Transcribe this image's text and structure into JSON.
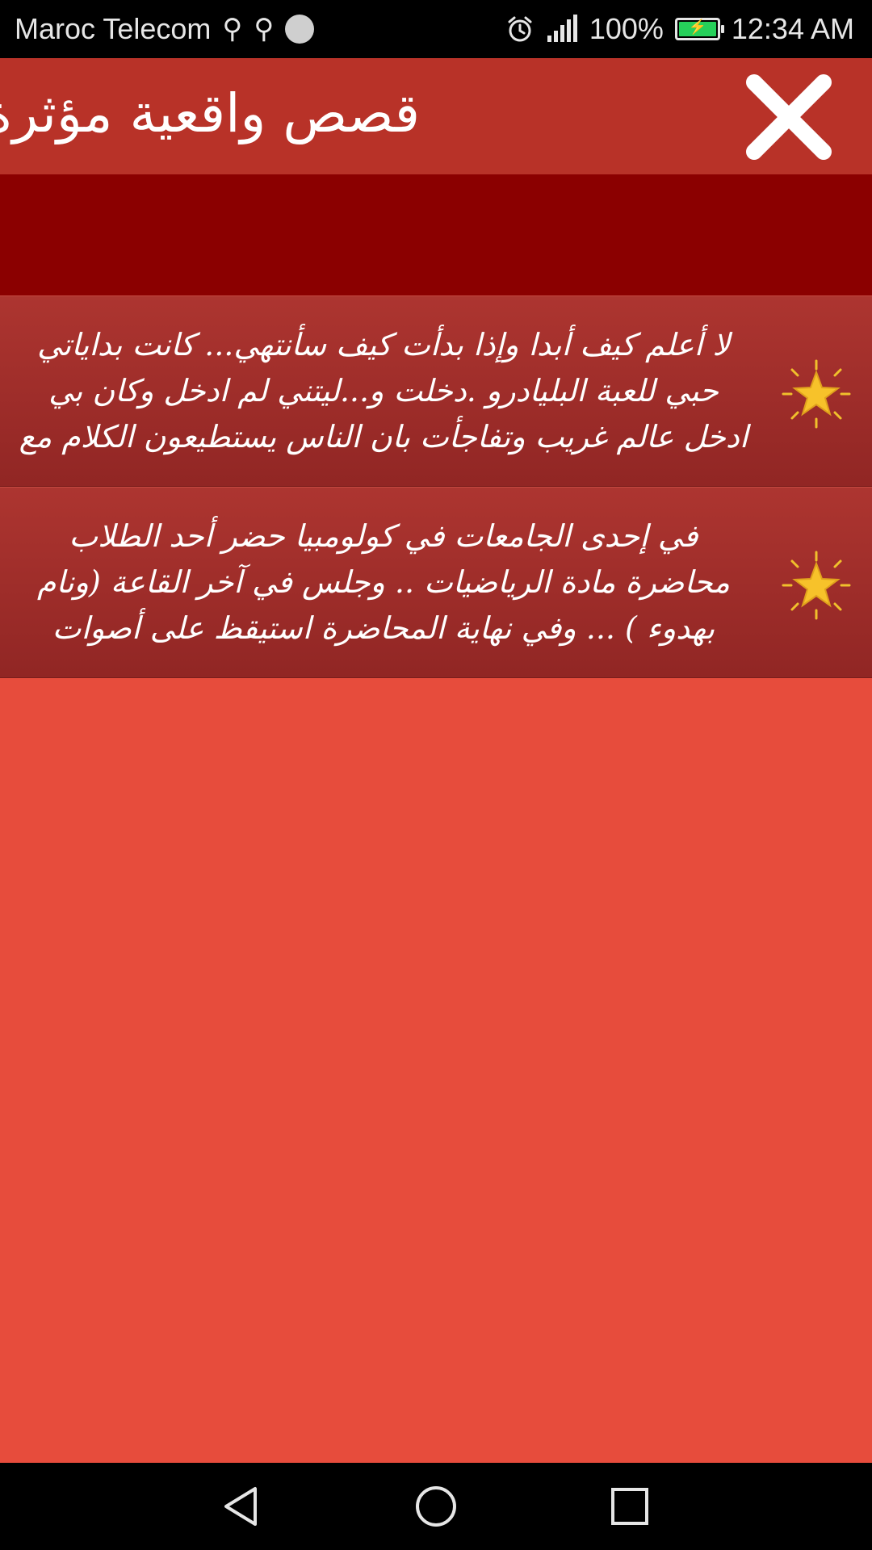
{
  "status_bar": {
    "carrier": "Maroc Telecom",
    "battery_percent": "100%",
    "battery_level": 1.0,
    "time": "12:34 AM",
    "icons": [
      "usb-icon",
      "usb-icon",
      "app-notification-icon",
      "alarm-icon",
      "signal-icon",
      "battery-charging-icon"
    ]
  },
  "header": {
    "title": "قصص واقعية مؤثرة",
    "close_icon": "close-icon"
  },
  "stories": [
    {
      "icon": "star-icon",
      "text": "لا أعلم كيف أبدا وإذا بدأت كيف سأنتهي... كانت بداياتي حبي للعبة البليادرو .دخلت و...ليتني لم ادخل وكان بي ادخل عالم غريب وتفاجأت بان الناس يستطيعون الكلام مع بعضهم ,"
    },
    {
      "icon": "star-icon",
      "text": "في إحدى الجامعات في كولومبيا حضر أحد الطلاب محاضرة مادة الرياضيات .. وجلس في آخر القاعة (ونام بهدوء ) ... وفي نهاية المحاضرة استيقظ على أصوات الطلاب .... ونظر"
    }
  ],
  "colors": {
    "background": "#e74c3c",
    "header": "#b83228",
    "dark_band": "#8b0000",
    "list_item": "#a02e2b",
    "star": "#f7c22a"
  },
  "nav_bar": {
    "icons": [
      "back-icon",
      "home-icon",
      "recent-apps-icon"
    ]
  }
}
